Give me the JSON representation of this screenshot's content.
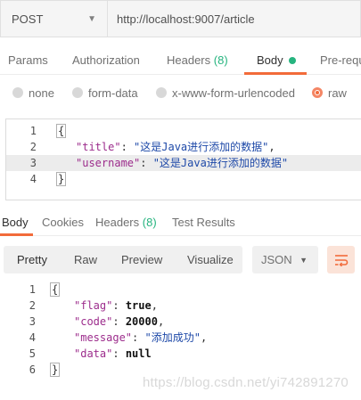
{
  "request": {
    "method": "POST",
    "url": "http://localhost:9007/article"
  },
  "request_tabs": {
    "params": "Params",
    "authorization": "Authorization",
    "headers_label": "Headers",
    "headers_count": "(8)",
    "body": "Body",
    "pre_request": "Pre-requ"
  },
  "body_types": {
    "none": "none",
    "form_data": "form-data",
    "urlencoded": "x-www-form-urlencoded",
    "raw": "raw",
    "selected": "raw"
  },
  "request_body": {
    "lines": [
      {
        "num": "1",
        "text": "{"
      },
      {
        "num": "2",
        "key": "\"title\"",
        "sep": ": ",
        "value": "\"这是Java进行添加的数据\"",
        "end": ","
      },
      {
        "num": "3",
        "key": "\"username\"",
        "sep": ": ",
        "value": "\"这是Java进行添加的数据\"",
        "end": ""
      },
      {
        "num": "4",
        "text": "}"
      }
    ]
  },
  "response_tabs": {
    "body": "Body",
    "cookies": "Cookies",
    "headers_label": "Headers",
    "headers_count": "(8)",
    "test_results": "Test Results"
  },
  "response_toolbar": {
    "pretty": "Pretty",
    "raw": "Raw",
    "preview": "Preview",
    "visualize": "Visualize",
    "format": "JSON",
    "active": "Pretty"
  },
  "response_body": {
    "lines": [
      {
        "num": "1",
        "text": "{"
      },
      {
        "num": "2",
        "key": "\"flag\"",
        "sep": ": ",
        "value": "true",
        "end": ","
      },
      {
        "num": "3",
        "key": "\"code\"",
        "sep": ": ",
        "value": "20000",
        "end": ","
      },
      {
        "num": "4",
        "key": "\"message\"",
        "sep": ": ",
        "value": "\"添加成功\"",
        "end": ","
      },
      {
        "num": "5",
        "key": "\"data\"",
        "sep": ": ",
        "value": "null",
        "end": ""
      },
      {
        "num": "6",
        "text": "}"
      }
    ]
  },
  "watermark": "https://blog.csdn.net/yi742891270",
  "colors": {
    "accent": "#f26b3a",
    "count_green": "#26b47f",
    "json_key": "#9c2c8c",
    "json_string": "#1e49a8"
  },
  "icons": {
    "method_dropdown": "chevron-down-icon",
    "format_dropdown": "chevron-down-icon",
    "wrap": "text-wrap-icon"
  }
}
